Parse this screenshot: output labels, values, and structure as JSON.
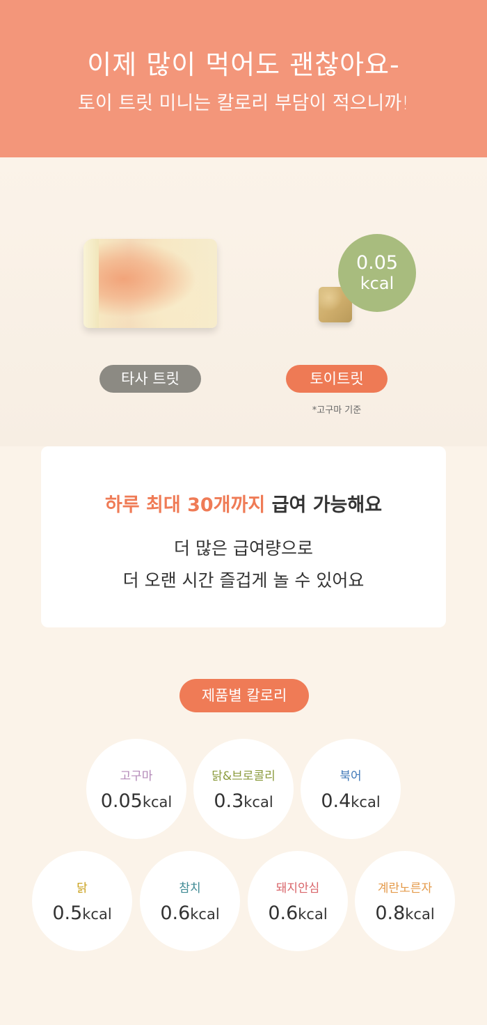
{
  "header": {
    "title": "이제 많이 먹어도 괜찮아요-",
    "subtitle": "토이 트릿 미니는 칼로리 부담이 적으니까!"
  },
  "comparison": {
    "toy_kcal_value": "0.05",
    "toy_kcal_unit": "kcal",
    "other_label": "타사 트릿",
    "toy_label": "토이트릿",
    "footnote": "*고구마 기준"
  },
  "card": {
    "title_highlight": "하루 최대 30개까지",
    "title_rest": "급여 가능해요",
    "line1": "더 많은 급여량으로",
    "line2": "더 오랜 시간 즐겁게 놀 수 있어요"
  },
  "calories": {
    "section_label": "제품별 칼로리",
    "items": [
      {
        "name": "고구마",
        "value": "0.05",
        "unit": "kcal",
        "color": "#b48ab8"
      },
      {
        "name": "닭&브로콜리",
        "value": "0.3",
        "unit": "kcal",
        "color": "#8a9a3c"
      },
      {
        "name": "북어",
        "value": "0.4",
        "unit": "kcal",
        "color": "#3f78b8"
      },
      {
        "name": "닭",
        "value": "0.5",
        "unit": "kcal",
        "color": "#c9a01a"
      },
      {
        "name": "참치",
        "value": "0.6",
        "unit": "kcal",
        "color": "#3f8a94"
      },
      {
        "name": "돼지안심",
        "value": "0.6",
        "unit": "kcal",
        "color": "#d9656a"
      },
      {
        "name": "계란노른자",
        "value": "0.8",
        "unit": "kcal",
        "color": "#e49a4a"
      }
    ]
  },
  "colors": {
    "header_bg": "#f3967a",
    "accent": "#ef7b56",
    "green_bubble": "#a8bc7e",
    "gray_pill": "#8c8a83",
    "page_bg": "#fbf3e9"
  }
}
